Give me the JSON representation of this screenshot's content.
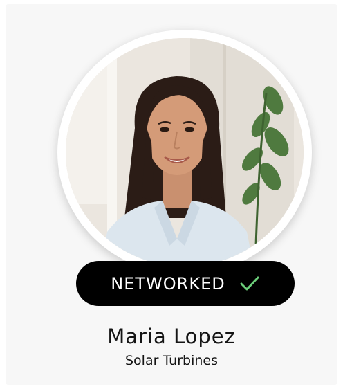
{
  "profile": {
    "name": "Maria Lopez",
    "company": "Solar Turbines"
  },
  "status": {
    "label": "NETWORKED",
    "icon": "check-icon"
  },
  "colors": {
    "pill_background": "#000000",
    "pill_text": "#ffffff",
    "check_accent": "#6ccf7a",
    "text_primary": "#151515",
    "card_background": "#f7f7f7"
  }
}
